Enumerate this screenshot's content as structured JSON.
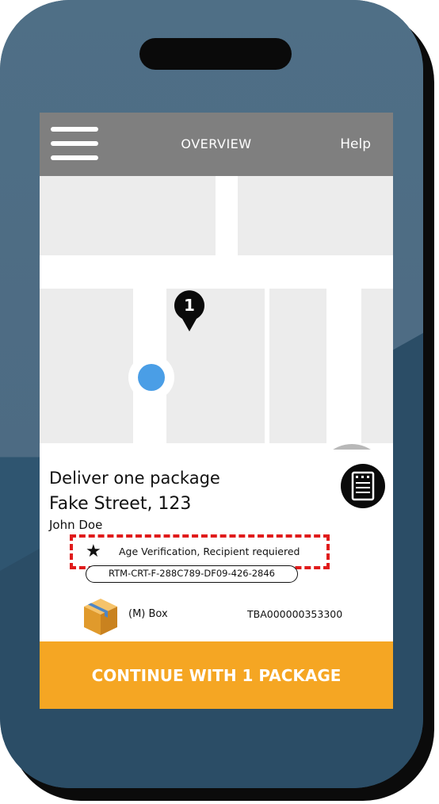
{
  "header": {
    "title": "OVERVIEW",
    "help_label": "Help"
  },
  "map": {
    "stop_number": "1"
  },
  "delivery": {
    "heading": "Deliver one package",
    "address": "Fake Street, 123",
    "recipient": "John Doe",
    "requirement": "Age Verification, Recipient requiered",
    "tracking_code": "RTM-CRT-F-288C789-DF09-426-2846",
    "package_size": "(M) Box",
    "package_id": "TBA000000353300"
  },
  "actions": {
    "continue_label": "CONTINUE WITH 1 PACKAGE"
  },
  "icons": {
    "menu": "hamburger-menu-icon",
    "pin": "map-pin-icon",
    "location": "current-location-icon",
    "navigate": "navigation-arrow-icon",
    "document": "delivery-notes-icon",
    "star": "star-icon",
    "box": "package-box-icon"
  },
  "colors": {
    "header_bg": "#7f7f7f",
    "cta_bg": "#f5a623",
    "location_dot": "#4a9ee6",
    "highlight_border": "#e01b1b",
    "phone_body": "#4d6b83"
  }
}
